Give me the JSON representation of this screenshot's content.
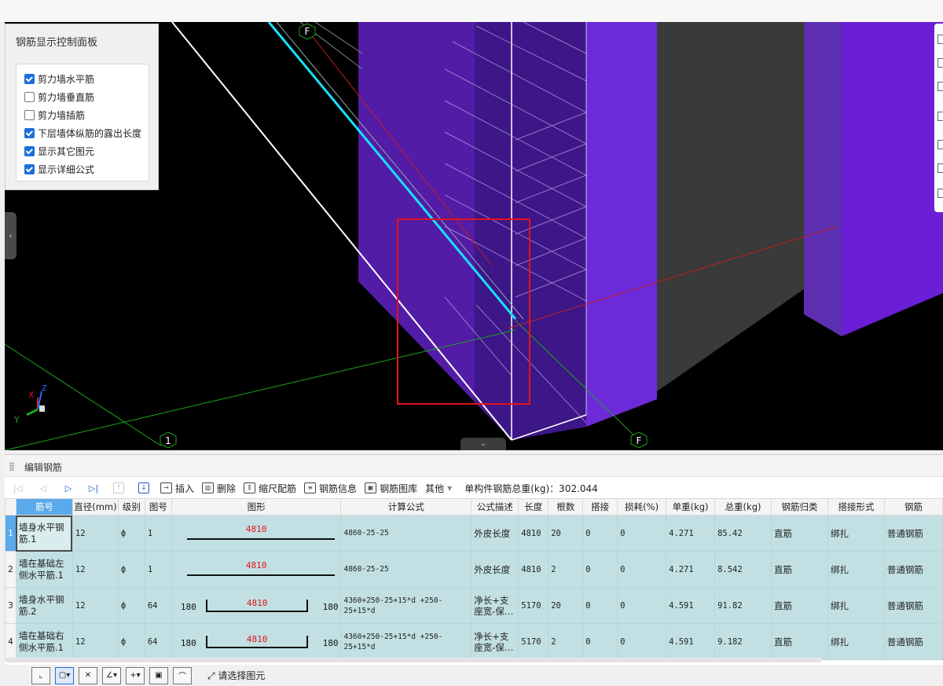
{
  "control_panel": {
    "title": "钢筋显示控制面板",
    "options": [
      {
        "label": "剪力墙水平筋",
        "checked": true
      },
      {
        "label": "剪力墙垂直筋",
        "checked": false
      },
      {
        "label": "剪力墙插筋",
        "checked": false
      },
      {
        "label": "下层墙体纵筋的露出长度",
        "checked": true
      },
      {
        "label": "显示其它图元",
        "checked": true
      },
      {
        "label": "显示详细公式",
        "checked": true
      }
    ]
  },
  "viewport": {
    "axis_labels": [
      "F",
      "1",
      "F"
    ],
    "gizmo": {
      "x": "X",
      "y": "Y",
      "z": "Z"
    }
  },
  "edit_panel": {
    "title": "编辑钢筋",
    "toolbar": {
      "insert": "插入",
      "delete": "删除",
      "scale_rebar": "缩尺配筋",
      "rebar_info": "钢筋信息",
      "rebar_library": "钢筋图库",
      "other": "其他",
      "total_weight": "单构件钢筋总重(kg)：302.044"
    },
    "columns": [
      "筋号",
      "直径(mm)",
      "级别",
      "图号",
      "图形",
      "计算公式",
      "公式描述",
      "长度",
      "根数",
      "搭接",
      "损耗(%)",
      "单重(kg)",
      "总重(kg)",
      "钢筋归类",
      "搭接形式",
      "钢筋"
    ],
    "rows": [
      {
        "num": "1",
        "name": "墙身水平钢筋.1",
        "dia": "12",
        "grade": "ф",
        "fig": "1",
        "shape_mid": "4810",
        "shape_left": "",
        "shape_right": "",
        "formula": "4860-25-25",
        "desc": "外皮长度",
        "length": "4810",
        "count": "20",
        "lap": "0",
        "loss": "0",
        "unit_w": "4.271",
        "total_w": "85.42",
        "category": "直筋",
        "lap_type": "绑扎",
        "rebar_type": "普通钢筋"
      },
      {
        "num": "2",
        "name": "墙在基础左侧水平筋.1",
        "dia": "12",
        "grade": "ф",
        "fig": "1",
        "shape_mid": "4810",
        "shape_left": "",
        "shape_right": "",
        "formula": "4860-25-25",
        "desc": "外皮长度",
        "length": "4810",
        "count": "2",
        "lap": "0",
        "loss": "0",
        "unit_w": "4.271",
        "total_w": "8.542",
        "category": "直筋",
        "lap_type": "绑扎",
        "rebar_type": "普通钢筋"
      },
      {
        "num": "3",
        "name": "墙身水平钢筋.2",
        "dia": "12",
        "grade": "ф",
        "fig": "64",
        "shape_mid": "4810",
        "shape_left": "180",
        "shape_right": "180",
        "formula": "4360+250-25+15*d +250-25+15*d",
        "desc": "净长+支座宽-保…",
        "length": "5170",
        "count": "20",
        "lap": "0",
        "loss": "0",
        "unit_w": "4.591",
        "total_w": "91.82",
        "category": "直筋",
        "lap_type": "绑扎",
        "rebar_type": "普通钢筋"
      },
      {
        "num": "4",
        "name": "墙在基础右侧水平筋.1",
        "dia": "12",
        "grade": "ф",
        "fig": "64",
        "shape_mid": "4810",
        "shape_left": "180",
        "shape_right": "180",
        "formula": "4360+250-25+15*d +250-25+15*d",
        "desc": "净长+支座宽-保…",
        "length": "5170",
        "count": "2",
        "lap": "0",
        "loss": "0",
        "unit_w": "4.591",
        "total_w": "9.182",
        "category": "直筋",
        "lap_type": "绑扎",
        "rebar_type": "普通钢筋"
      }
    ]
  },
  "status_bar": {
    "prompt": "请选择图元"
  },
  "colors": {
    "selection_blue": "#5aa9ea",
    "row_teal": "#c2e0e3",
    "wall_purple": "#6a1fc9",
    "rebar_cyan": "#19e0ff",
    "highlight_red": "#e3131b"
  }
}
